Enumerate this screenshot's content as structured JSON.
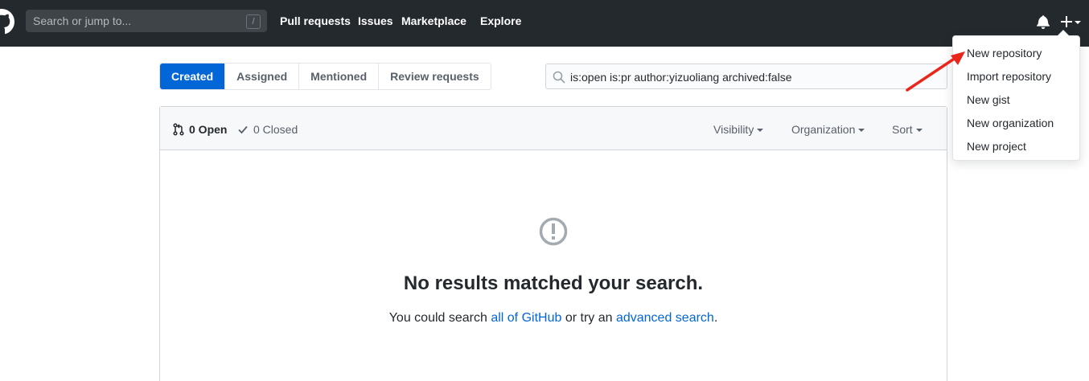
{
  "header": {
    "search_placeholder": "Search or jump to...",
    "slash_key": "/",
    "nav": [
      "Pull requests",
      "Issues",
      "Marketplace",
      "Explore"
    ]
  },
  "tabs": [
    "Created",
    "Assigned",
    "Mentioned",
    "Review requests"
  ],
  "filter": {
    "query": "is:open is:pr author:yizuoliang archived:false"
  },
  "states": {
    "open": "0 Open",
    "closed": "0 Closed"
  },
  "dropdowns": {
    "visibility": "Visibility",
    "organization": "Organization",
    "sort": "Sort"
  },
  "blankslate": {
    "title": "No results matched your search.",
    "text_prefix": "You could search ",
    "link1": "all of GitHub",
    "text_middle": " or try an ",
    "link2": "advanced search",
    "text_suffix": "."
  },
  "create_menu": {
    "items": [
      "New repository",
      "Import repository",
      "New gist",
      "New organization",
      "New project"
    ]
  },
  "colors": {
    "header_bg": "#24292e",
    "accent": "#0366d6",
    "annotation_arrow": "#e8261c"
  }
}
